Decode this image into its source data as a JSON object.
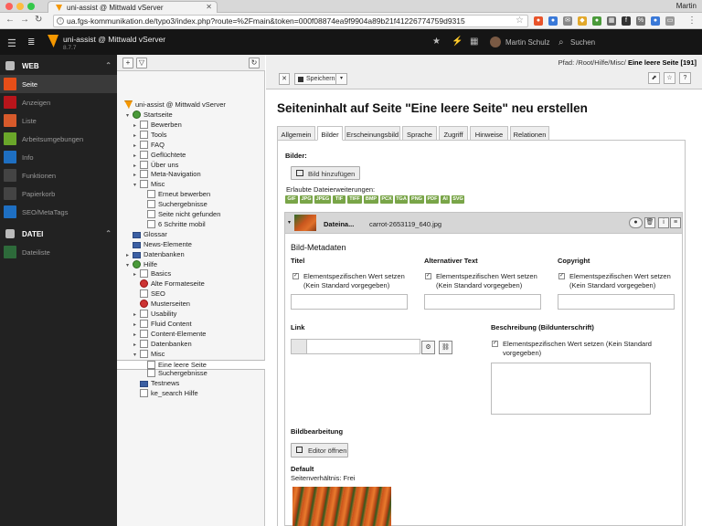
{
  "browser": {
    "tab_title": "uni-assist @ Mittwald vServer",
    "user": "Martin",
    "url": "ua.fgs-kommunikation.de/typo3/index.php?route=%2Fmain&token=000f08874ea9f9904a89b21f41226774759d9315"
  },
  "topbar": {
    "site_name": "uni-assist @ Mittwald vServer",
    "version": "8.7.7",
    "user_name": "Martin Schulz",
    "search_label": "Suchen"
  },
  "modules": {
    "web_label": "WEB",
    "file_label": "DATEI",
    "web_items": [
      {
        "label": "Seite",
        "color": "#e64e18"
      },
      {
        "label": "Anzeigen",
        "color": "#b8151b"
      },
      {
        "label": "Liste",
        "color": "#d75a2b"
      },
      {
        "label": "Arbeitsumgebungen",
        "color": "#6aa62a"
      },
      {
        "label": "Info",
        "color": "#1e6fc2"
      },
      {
        "label": "Funktionen",
        "color": "#444444"
      },
      {
        "label": "Papierkorb",
        "color": "#444444"
      },
      {
        "label": "SEO/MetaTags",
        "color": "#1e6fc2"
      }
    ],
    "file_items": [
      {
        "label": "Dateiliste",
        "color": "#2d6a3a"
      }
    ]
  },
  "tree": {
    "root": "uni-assist @ Mittwald vServer",
    "nodes": [
      {
        "label": "Startseite",
        "type": "globe",
        "level": 1,
        "exp": "▾"
      },
      {
        "label": "Bewerben",
        "type": "page",
        "level": 2,
        "exp": "▸"
      },
      {
        "label": "Tools",
        "type": "page",
        "level": 2,
        "exp": "▸"
      },
      {
        "label": "FAQ",
        "type": "page",
        "level": 2,
        "exp": "▸"
      },
      {
        "label": "Geflüchtete",
        "type": "page",
        "level": 2,
        "exp": "▸"
      },
      {
        "label": "Über uns",
        "type": "page",
        "level": 2,
        "exp": "▸"
      },
      {
        "label": "Meta-Navigation",
        "type": "page",
        "level": 2,
        "exp": "▸"
      },
      {
        "label": "Misc",
        "type": "page",
        "level": 2,
        "exp": "▾"
      },
      {
        "label": "Erneut bewerben",
        "type": "page",
        "level": 3,
        "exp": ""
      },
      {
        "label": "Suchergebnisse",
        "type": "page",
        "level": 3,
        "exp": ""
      },
      {
        "label": "Seite nicht gefunden",
        "type": "page",
        "level": 3,
        "exp": ""
      },
      {
        "label": "6 Schritte mobil",
        "type": "page",
        "level": 3,
        "exp": ""
      },
      {
        "label": "Glossar",
        "type": "folder",
        "level": 1,
        "exp": ""
      },
      {
        "label": "News-Elemente",
        "type": "folder",
        "level": 1,
        "exp": ""
      },
      {
        "label": "Datenbanken",
        "type": "folder",
        "level": 1,
        "exp": "▸"
      },
      {
        "label": "Hilfe",
        "type": "globe",
        "level": 1,
        "exp": "▾"
      },
      {
        "label": "Basics",
        "type": "page",
        "level": 2,
        "exp": "▸"
      },
      {
        "label": "Alte Formateseite",
        "type": "red",
        "level": 2,
        "exp": ""
      },
      {
        "label": "SEO",
        "type": "page",
        "level": 2,
        "exp": ""
      },
      {
        "label": "Musterseiten",
        "type": "red",
        "level": 2,
        "exp": ""
      },
      {
        "label": "Usability",
        "type": "page",
        "level": 2,
        "exp": "▸"
      },
      {
        "label": "Fluid Content",
        "type": "page",
        "level": 2,
        "exp": "▸"
      },
      {
        "label": "Content-Elemente",
        "type": "page",
        "level": 2,
        "exp": "▸"
      },
      {
        "label": "Datenbanken",
        "type": "page",
        "level": 2,
        "exp": "▸"
      },
      {
        "label": "Misc",
        "type": "page",
        "level": 2,
        "exp": "▾"
      },
      {
        "label": "Eine leere Seite",
        "type": "page",
        "level": 3,
        "exp": "",
        "selected": true
      },
      {
        "label": "Suchergebnisse",
        "type": "page",
        "level": 3,
        "exp": ""
      },
      {
        "label": "Testnews",
        "type": "folder",
        "level": 2,
        "exp": ""
      },
      {
        "label": "ke_search Hilfe",
        "type": "page",
        "level": 2,
        "exp": ""
      }
    ]
  },
  "doc": {
    "path_label": "Pfad: /Root/Hilfe/Misc/",
    "path_page": "Eine leere Seite [191]",
    "save_label": "Speichern",
    "title": "Seiteninhalt auf Seite \"Eine leere Seite\" neu erstellen"
  },
  "tabs": [
    "Allgemein",
    "Bilder",
    "Erscheinungsbild",
    "Sprache",
    "Zugriff",
    "Hinweise",
    "Relationen"
  ],
  "images": {
    "section_label": "Bilder:",
    "add_button": "Bild hinzufügen",
    "allowed_label": "Erlaubte Dateierweiterungen:",
    "extensions": [
      "GIF",
      "JPG",
      "JPEG",
      "TIF",
      "TIFF",
      "BMP",
      "PCX",
      "TGA",
      "PNG",
      "PDF",
      "AI",
      "SVG"
    ],
    "file_header_short": "Dateina...",
    "file_name": "carrot-2653119_640.jpg",
    "meta_title": "Bild-Metadaten",
    "col_title": "Titel",
    "col_alt": "Alternativer Text",
    "col_copyright": "Copyright",
    "override_label_a": "Elementspezifischen Wert setzen",
    "override_label_b": "(Kein Standard vorgegeben)",
    "override_long_a": "Elementspezifischen Wert setzen (Kein Standard",
    "override_long_b": "vorgegeben)",
    "link_label": "Link",
    "description_label": "Beschreibung (Bildunterschrift)",
    "editing_label": "Bildbearbeitung",
    "editor_button": "Editor öffnen",
    "default_label": "Default",
    "ratio_label": "Seitenverhältnis: Frei"
  }
}
